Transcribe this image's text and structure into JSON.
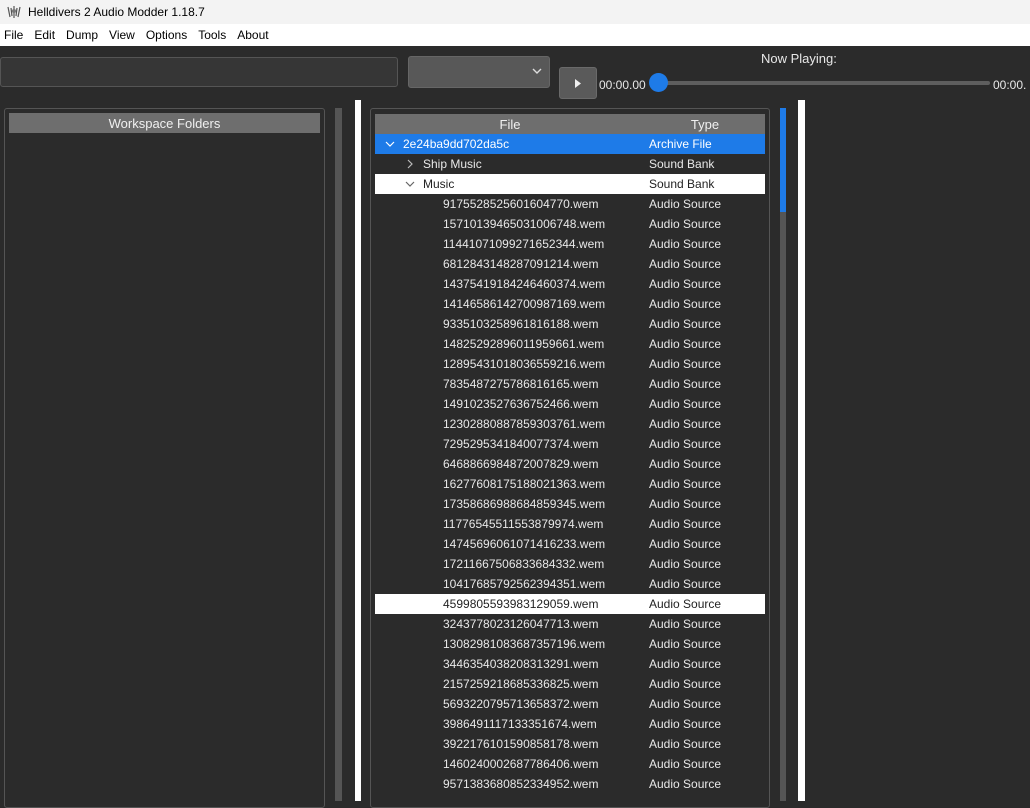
{
  "window": {
    "title": "Helldivers 2 Audio Modder 1.18.7"
  },
  "menu": [
    "File",
    "Edit",
    "Dump",
    "View",
    "Options",
    "Tools",
    "About"
  ],
  "toolbar": {
    "search_value": "",
    "combo_value": "",
    "now_playing_label": "Now Playing:",
    "time_start": "00:00.00",
    "time_end": "00:00.",
    "progress": 0.0
  },
  "workspace": {
    "header": "Workspace Folders"
  },
  "tree": {
    "columns": {
      "file": "File",
      "type": "Type"
    },
    "rows": [
      {
        "name": "2e24ba9dd702da5c",
        "type": "Archive File",
        "level": 0,
        "expander": "down",
        "state": "selected"
      },
      {
        "name": "Ship Music",
        "type": "Sound Bank",
        "level": 1,
        "expander": "right",
        "state": ""
      },
      {
        "name": "Music",
        "type": "Sound Bank",
        "level": 1,
        "expander": "down",
        "state": "highlight"
      },
      {
        "name": "9175528525601604770.wem",
        "type": "Audio Source",
        "level": 2,
        "expander": "",
        "state": ""
      },
      {
        "name": "15710139465031006748.wem",
        "type": "Audio Source",
        "level": 2,
        "expander": "",
        "state": ""
      },
      {
        "name": "11441071099271652344.wem",
        "type": "Audio Source",
        "level": 2,
        "expander": "",
        "state": ""
      },
      {
        "name": "6812843148287091214.wem",
        "type": "Audio Source",
        "level": 2,
        "expander": "",
        "state": ""
      },
      {
        "name": "14375419184246460374.wem",
        "type": "Audio Source",
        "level": 2,
        "expander": "",
        "state": ""
      },
      {
        "name": "14146586142700987169.wem",
        "type": "Audio Source",
        "level": 2,
        "expander": "",
        "state": ""
      },
      {
        "name": "9335103258961816188.wem",
        "type": "Audio Source",
        "level": 2,
        "expander": "",
        "state": ""
      },
      {
        "name": "14825292896011959661.wem",
        "type": "Audio Source",
        "level": 2,
        "expander": "",
        "state": ""
      },
      {
        "name": "12895431018036559216.wem",
        "type": "Audio Source",
        "level": 2,
        "expander": "",
        "state": ""
      },
      {
        "name": "7835487275786816165.wem",
        "type": "Audio Source",
        "level": 2,
        "expander": "",
        "state": ""
      },
      {
        "name": "1491023527636752466.wem",
        "type": "Audio Source",
        "level": 2,
        "expander": "",
        "state": ""
      },
      {
        "name": "12302880887859303761.wem",
        "type": "Audio Source",
        "level": 2,
        "expander": "",
        "state": ""
      },
      {
        "name": "7295295341840077374.wem",
        "type": "Audio Source",
        "level": 2,
        "expander": "",
        "state": ""
      },
      {
        "name": "6468866984872007829.wem",
        "type": "Audio Source",
        "level": 2,
        "expander": "",
        "state": ""
      },
      {
        "name": "16277608175188021363.wem",
        "type": "Audio Source",
        "level": 2,
        "expander": "",
        "state": ""
      },
      {
        "name": "17358686988684859345.wem",
        "type": "Audio Source",
        "level": 2,
        "expander": "",
        "state": ""
      },
      {
        "name": "11776545511553879974.wem",
        "type": "Audio Source",
        "level": 2,
        "expander": "",
        "state": ""
      },
      {
        "name": "14745696061071416233.wem",
        "type": "Audio Source",
        "level": 2,
        "expander": "",
        "state": ""
      },
      {
        "name": "17211667506833684332.wem",
        "type": "Audio Source",
        "level": 2,
        "expander": "",
        "state": ""
      },
      {
        "name": "10417685792562394351.wem",
        "type": "Audio Source",
        "level": 2,
        "expander": "",
        "state": ""
      },
      {
        "name": "4599805593983129059.wem",
        "type": "Audio Source",
        "level": 2,
        "expander": "",
        "state": "highlight"
      },
      {
        "name": "3243778023126047713.wem",
        "type": "Audio Source",
        "level": 2,
        "expander": "",
        "state": ""
      },
      {
        "name": "13082981083687357196.wem",
        "type": "Audio Source",
        "level": 2,
        "expander": "",
        "state": ""
      },
      {
        "name": "3446354038208313291.wem",
        "type": "Audio Source",
        "level": 2,
        "expander": "",
        "state": ""
      },
      {
        "name": "2157259218685336825.wem",
        "type": "Audio Source",
        "level": 2,
        "expander": "",
        "state": ""
      },
      {
        "name": "5693220795713658372.wem",
        "type": "Audio Source",
        "level": 2,
        "expander": "",
        "state": ""
      },
      {
        "name": "3986491117133351674.wem",
        "type": "Audio Source",
        "level": 2,
        "expander": "",
        "state": ""
      },
      {
        "name": "3922176101590858178.wem",
        "type": "Audio Source",
        "level": 2,
        "expander": "",
        "state": ""
      },
      {
        "name": "14602400026877864​06.wem",
        "type": "Audio Source",
        "level": 2,
        "expander": "",
        "state": ""
      },
      {
        "name": "9571383680852334952.wem",
        "type": "Audio Source",
        "level": 2,
        "expander": "",
        "state": ""
      }
    ]
  },
  "colors": {
    "accent": "#1e7be8",
    "background": "#2b2b2b",
    "header": "#6e6e6e"
  }
}
